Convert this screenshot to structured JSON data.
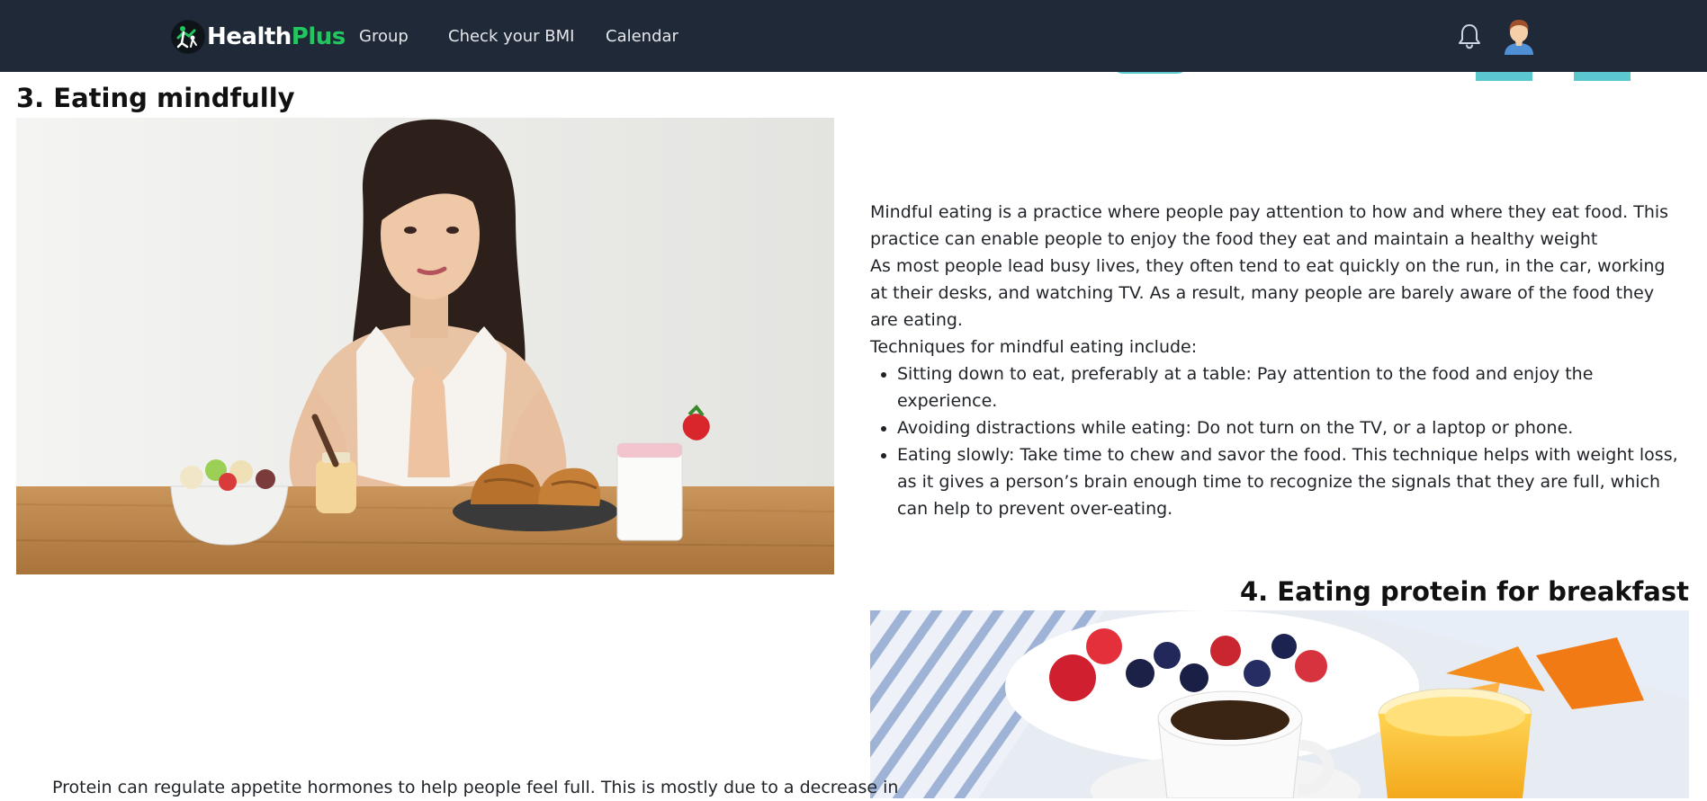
{
  "navbar": {
    "brand_health": "Health",
    "brand_plus": "Plus",
    "links": [
      "Group",
      "Check your BMI",
      "Calendar"
    ],
    "icons": [
      "bell-icon",
      "user-avatar"
    ]
  },
  "section3": {
    "title": "3. Eating mindfully",
    "paragraphs": [
      "Mindful eating is a practice where people pay attention to how and where they eat food. This practice can enable people to enjoy the food they eat and maintain a healthy weight",
      "As most people lead busy lives, they often tend to eat quickly on the run, in the car, working at their desks, and watching TV. As a result, many people are barely aware of the food they are eating.",
      "Techniques for mindful eating include:"
    ],
    "bullets": [
      "Sitting down to eat, preferably at a table: Pay attention to the food and enjoy the experience.",
      "Avoiding distractions while eating: Do not turn on the TV, or a laptop or phone.",
      "Eating slowly: Take time to chew and savor the food. This technique helps with weight loss, as it gives a person’s brain enough time to recognize the signals that they are full, which can help to prevent over-eating."
    ]
  },
  "section4": {
    "title": "4. Eating protein for breakfast",
    "paragraph_start": "Protein can regulate appetite hormones to help people feel full. This is mostly due to a decrease in"
  },
  "colors": {
    "navbar_bg": "#1f2937",
    "brand_plus": "#22c55e",
    "accent_teal": "#5bc8cf"
  }
}
